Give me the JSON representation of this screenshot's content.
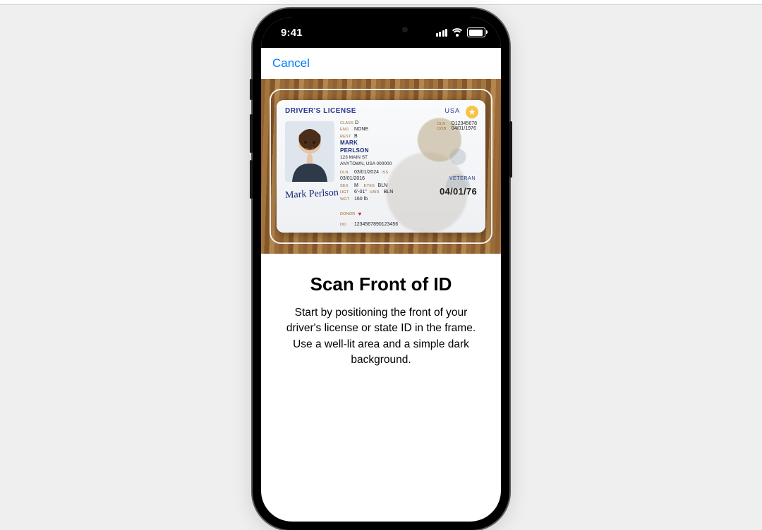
{
  "status": {
    "time": "9:41"
  },
  "nav": {
    "cancel": "Cancel"
  },
  "page": {
    "title": "Scan Front of ID",
    "body": "Start by positioning the front of your driver's license or state ID in the frame. Use a well-lit area and a simple dark background."
  },
  "license": {
    "header": "DRIVER'S LICENSE",
    "country": "USA",
    "class_lbl": "CLASS",
    "class": "D",
    "end_lbl": "END",
    "end": "NONE",
    "rest_lbl": "REST",
    "rest": "B",
    "first_name": "MARK",
    "last_name": "PERLSON",
    "addr1": "123 MAIN ST",
    "addr2": "ANYTOWN, USA 000000",
    "dln_lbl": "DLN",
    "dln": "D12345678",
    "dob_lbl": "DOB",
    "dob": "04/01/1976",
    "exp_lbl": "DLN",
    "exp": "03/01/2024",
    "iss_lbl": "ISS",
    "iss": "03/01/2016",
    "sex_lbl": "SEX",
    "sex": "M",
    "eyes_lbl": "EYES",
    "eyes": "BLN",
    "hgt_lbl": "HGT",
    "hgt": "6'-01\"",
    "hair_lbl": "HAIR",
    "hair": "BLN",
    "wgt_lbl": "WGT",
    "wgt": "160 lb",
    "veteran": "VETERAN",
    "big_dob": "04/01/76",
    "donor_lbl": "DONOR",
    "dd_lbl": "DD",
    "dd": "1234567890123456",
    "signature": "Mark Perlson"
  }
}
